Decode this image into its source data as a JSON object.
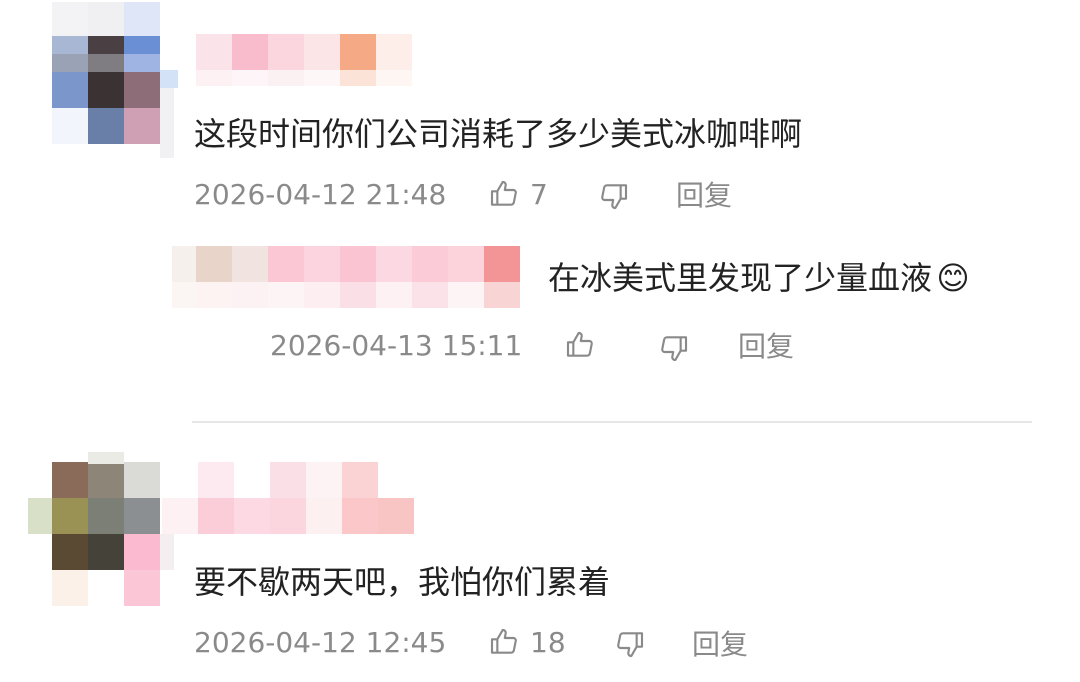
{
  "comments": [
    {
      "text": "这段时间你们公司消耗了多少美式冰咖啡啊",
      "timestamp": "2026-04-12 21:48",
      "likes": "7",
      "reply_label": "回复",
      "replies": [
        {
          "text": "在冰美式里发现了少量血液",
          "emoji": "😊",
          "timestamp": "2026-04-13 15:11",
          "likes": "",
          "reply_label": "回复"
        }
      ]
    },
    {
      "text": "要不歇两天吧，我怕你们累着",
      "timestamp": "2026-04-12 12:45",
      "likes": "18",
      "reply_label": "回复"
    }
  ],
  "icons": {
    "like": "thumbs-up-icon",
    "dislike": "thumbs-down-icon"
  }
}
